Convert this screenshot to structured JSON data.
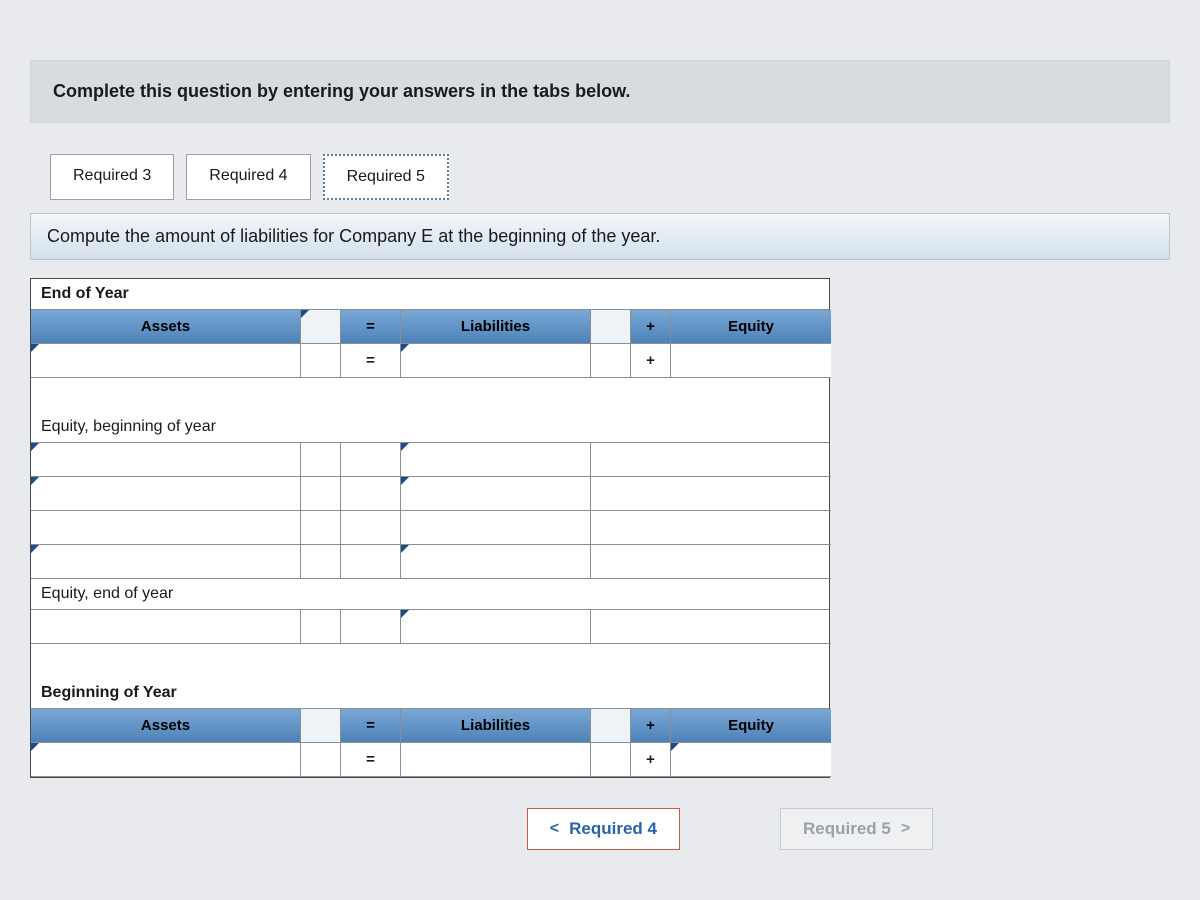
{
  "instruction": "Complete this question by entering your answers in the tabs below.",
  "tabs": [
    {
      "label": "Required 3",
      "selected": false
    },
    {
      "label": "Required 4",
      "selected": false
    },
    {
      "label": "Required 5",
      "selected": true
    }
  ],
  "sub_instruction": "Compute the amount of liabilities for Company E at the beginning of the year.",
  "sections": {
    "end_of_year": {
      "title": "End of Year",
      "headers": {
        "assets": "Assets",
        "liabilities": "Liabilities",
        "equity": "Equity"
      },
      "ops": {
        "eq": "=",
        "plus": "+"
      }
    },
    "equity_begin": {
      "title": "Equity, beginning of year"
    },
    "equity_end": {
      "title": "Equity, end of year"
    },
    "begin_of_year": {
      "title": "Beginning of Year",
      "headers": {
        "assets": "Assets",
        "liabilities": "Liabilities",
        "equity": "Equity"
      },
      "ops": {
        "eq": "=",
        "plus": "+"
      }
    }
  },
  "nav": {
    "prev": "Required 4",
    "next": "Required 5",
    "chev_left": "<",
    "chev_right": ">"
  }
}
